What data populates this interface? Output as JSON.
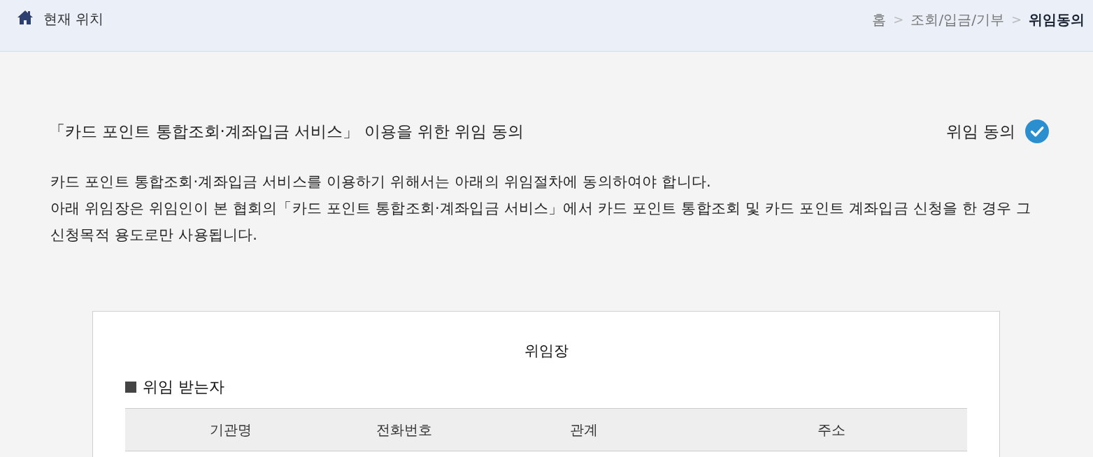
{
  "location_bar": {
    "label": "현재 위치",
    "breadcrumb": [
      {
        "label": "홈",
        "current": false,
        "separator": ">"
      },
      {
        "label": "조회/입금/기부",
        "current": false,
        "separator": ">"
      },
      {
        "label": "위임동의",
        "current": true
      }
    ]
  },
  "page": {
    "title": "「카드 포인트 통합조회·계좌입금 서비스」 이용을 위한 위임 동의",
    "consent": {
      "label": "위임 동의",
      "checked": true
    },
    "intro": [
      "카드 포인트 통합조회·계좌입금 서비스를 이용하기 위해서는 아래의 위임절차에 동의하여야 합니다.",
      "아래 위임장은 위임인이 본 협회의「카드 포인트 통합조회·계좌입금 서비스」에서 카드 포인트 통합조회 및 카드 포인트 계좌입금 신청을 한 경우 그 신청목적 용도로만 사용됩니다."
    ]
  },
  "document": {
    "title": "위임장",
    "section": "위임 받는자",
    "table": {
      "columns": [
        "기관명",
        "전화번호",
        "관계",
        "주소"
      ]
    }
  }
}
